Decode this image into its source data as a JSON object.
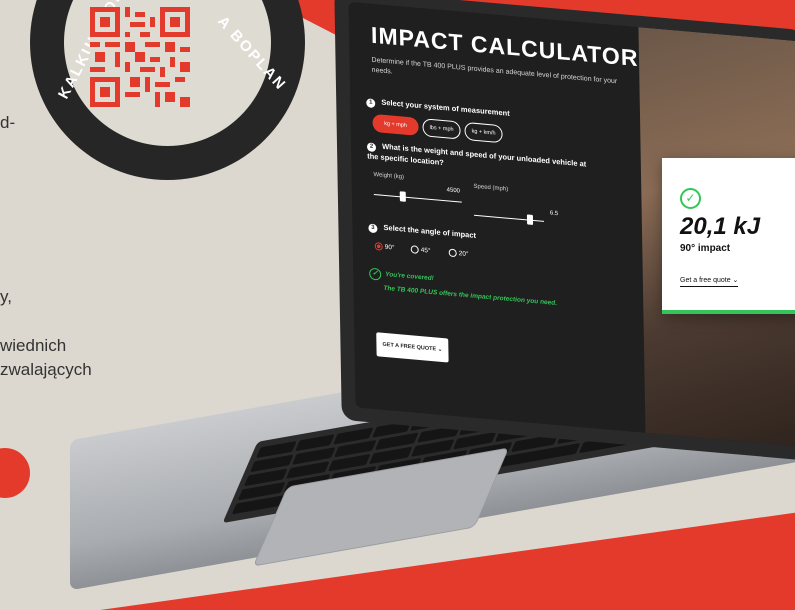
{
  "background": {
    "colors": {
      "accent": "#e33a2c",
      "beige": "#dcd8cf",
      "dark": "#262626",
      "success": "#33c559"
    },
    "badge_text_top": "KALKULATOR",
    "badge_text_right": "A BOPLAN",
    "side_text": [
      "d-",
      "y,",
      "wiednich",
      "zwalających"
    ]
  },
  "calculator": {
    "title": "IMPACT CALCULATOR",
    "subtitle": "Determine if the TB 400 PLUS provides an adequate level of protection for your needs.",
    "step1": {
      "num": "1",
      "label": "Select your system of measurement",
      "options": [
        "kg + mph",
        "lbs + mph",
        "kg + km/h"
      ]
    },
    "step2": {
      "num": "2",
      "label": "What is the weight and speed of your unloaded vehicle at the specific location?",
      "weight_label": "Weight (kg)",
      "weight_value": "4500",
      "speed_label": "Speed (mph)",
      "speed_value": "6.5"
    },
    "step3": {
      "num": "3",
      "label": "Select the angle of impact",
      "options": [
        "90°",
        "45°",
        "20°"
      ],
      "selected": "90°"
    },
    "covered_title": "You're covered!",
    "covered_text": "The TB 400 PLUS offers the impact protection you need.",
    "quote_button": "GET A FREE QUOTE"
  },
  "result_card": {
    "value": "20,1 kJ",
    "angle": "90° impact",
    "link": "Get a free quote"
  }
}
